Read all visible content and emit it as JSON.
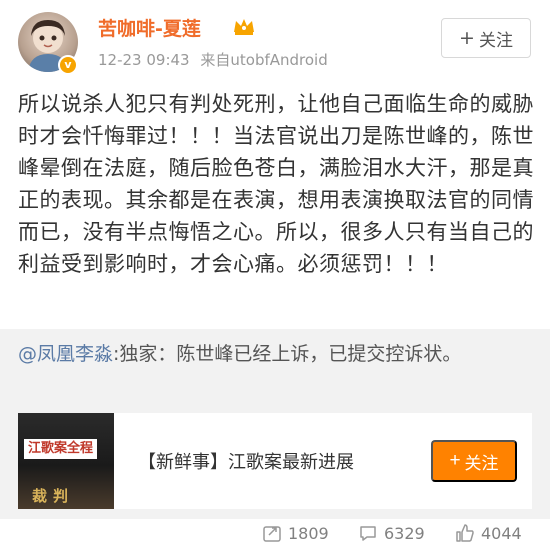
{
  "post": {
    "username": "苦咖啡-夏莲",
    "timestamp": "12-23 09:43",
    "source": "来自utobfAndroid",
    "follow_label": "关注",
    "body": "所以说杀人犯只有判处死刑，让他自己面临生命的威胁时才会忏悔罪过！！！当法官说出刀是陈世峰的，陈世峰晕倒在法庭，随后脸色苍白，满脸泪水大汗，那是真正的表现。其余都是在表演，想用表演换取法官的同情而已，没有半点悔悟之心。所以，很多人只有当自己的利益受到影响时，才会心痛。必须惩罚！！！"
  },
  "repost": {
    "user": "@凤凰李淼",
    "text": ":独家：陈世峰已经上诉，已提交控诉状。",
    "card": {
      "thumb_label": "江歌案全程",
      "thumb_sign": "裁判",
      "title": "【新鲜事】江歌案最新进展",
      "follow_label": "关注"
    }
  },
  "actions": {
    "reposts": "1809",
    "comments": "6329",
    "likes": "4044"
  },
  "colors": {
    "username": "#f06c2a",
    "accent": "#ff8200",
    "link": "#5b7ba6",
    "muted": "#999999"
  },
  "icons": [
    "vip-badge-icon",
    "crown-icon",
    "repost-icon",
    "comment-icon",
    "like-icon"
  ]
}
